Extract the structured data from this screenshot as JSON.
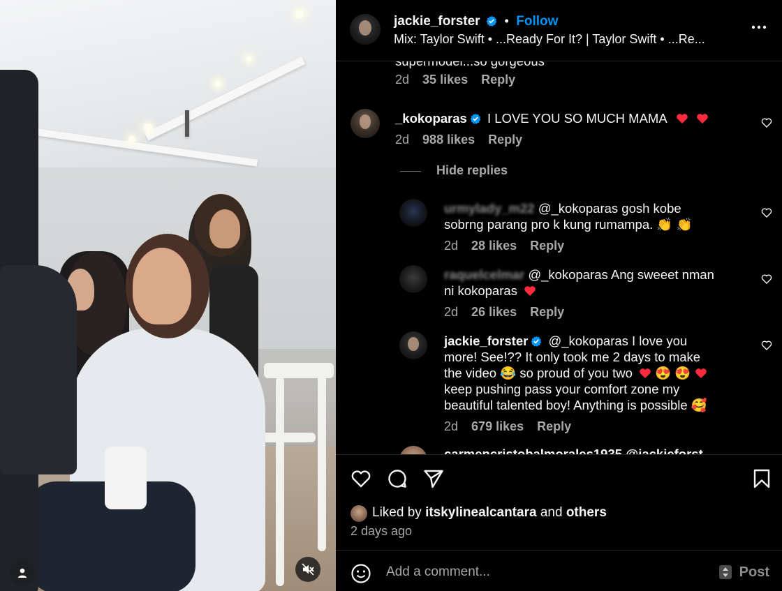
{
  "post": {
    "author": "jackie_forster",
    "follow_label": "Follow",
    "separator": "•",
    "audio": "Mix: Taylor Swift • ...Ready For It? | Taylor Swift • ...Re...",
    "more_label": "..."
  },
  "comments": [
    {
      "text_cutoff": "supermodel...so gorgeous",
      "age": "2d",
      "likes": "35 likes",
      "reply_label": "Reply"
    },
    {
      "username": "_kokoparas",
      "text": "I LOVE YOU SO MUCH MAMA",
      "age": "2d",
      "likes": "988 likes",
      "reply_label": "Reply",
      "hide_replies_label": "Hide replies",
      "replies": [
        {
          "username": "urmylady_m22",
          "text_line1": "@_kokoparas gosh kobe",
          "text_line2": "sobrng parang pro k kung rumampa.",
          "emoji": "👏 👏",
          "age": "2d",
          "likes": "28 likes",
          "reply_label": "Reply"
        },
        {
          "username": "raquelcelmar",
          "text_line1": "@_kokoparas Ang sweeet nman",
          "text_line2": "ni kokoparas",
          "age": "2d",
          "likes": "26 likes",
          "reply_label": "Reply"
        },
        {
          "username": "jackie_forster",
          "text_line1": "@_kokoparas I love you",
          "text_line2": "more! See!?? It only took me 2 days to make",
          "text_line3": "the video 😂 so proud of you two",
          "text_line3_emoji": "😍 😍",
          "text_line4": "keep pushing pass your comfort zone my",
          "text_line5": "beautiful talented boy! Anything is possible 🥰",
          "age": "2d",
          "likes": "679 likes",
          "reply_label": "Reply"
        },
        {
          "username_cutoff": "carmencristobalmorales1935 @jackieforst"
        }
      ]
    }
  ],
  "engagement": {
    "liked_prefix": "Liked by",
    "liked_user": "itskylinealcantara",
    "liked_and": "and",
    "liked_others": "others",
    "posted_ago": "2 days ago"
  },
  "composer": {
    "placeholder": "Add a comment...",
    "post_label": "Post"
  },
  "icons": {
    "like": "heart-icon",
    "comment": "comment-icon",
    "share": "share-icon",
    "save": "bookmark-icon",
    "emoji": "emoji-icon",
    "mute": "muted-speaker-icon",
    "tag": "user-tag-icon"
  },
  "colors": {
    "background": "#000000",
    "link_blue": "#0095f6",
    "secondary_text": "#a8a8a8",
    "heart_red": "#ff3040"
  }
}
